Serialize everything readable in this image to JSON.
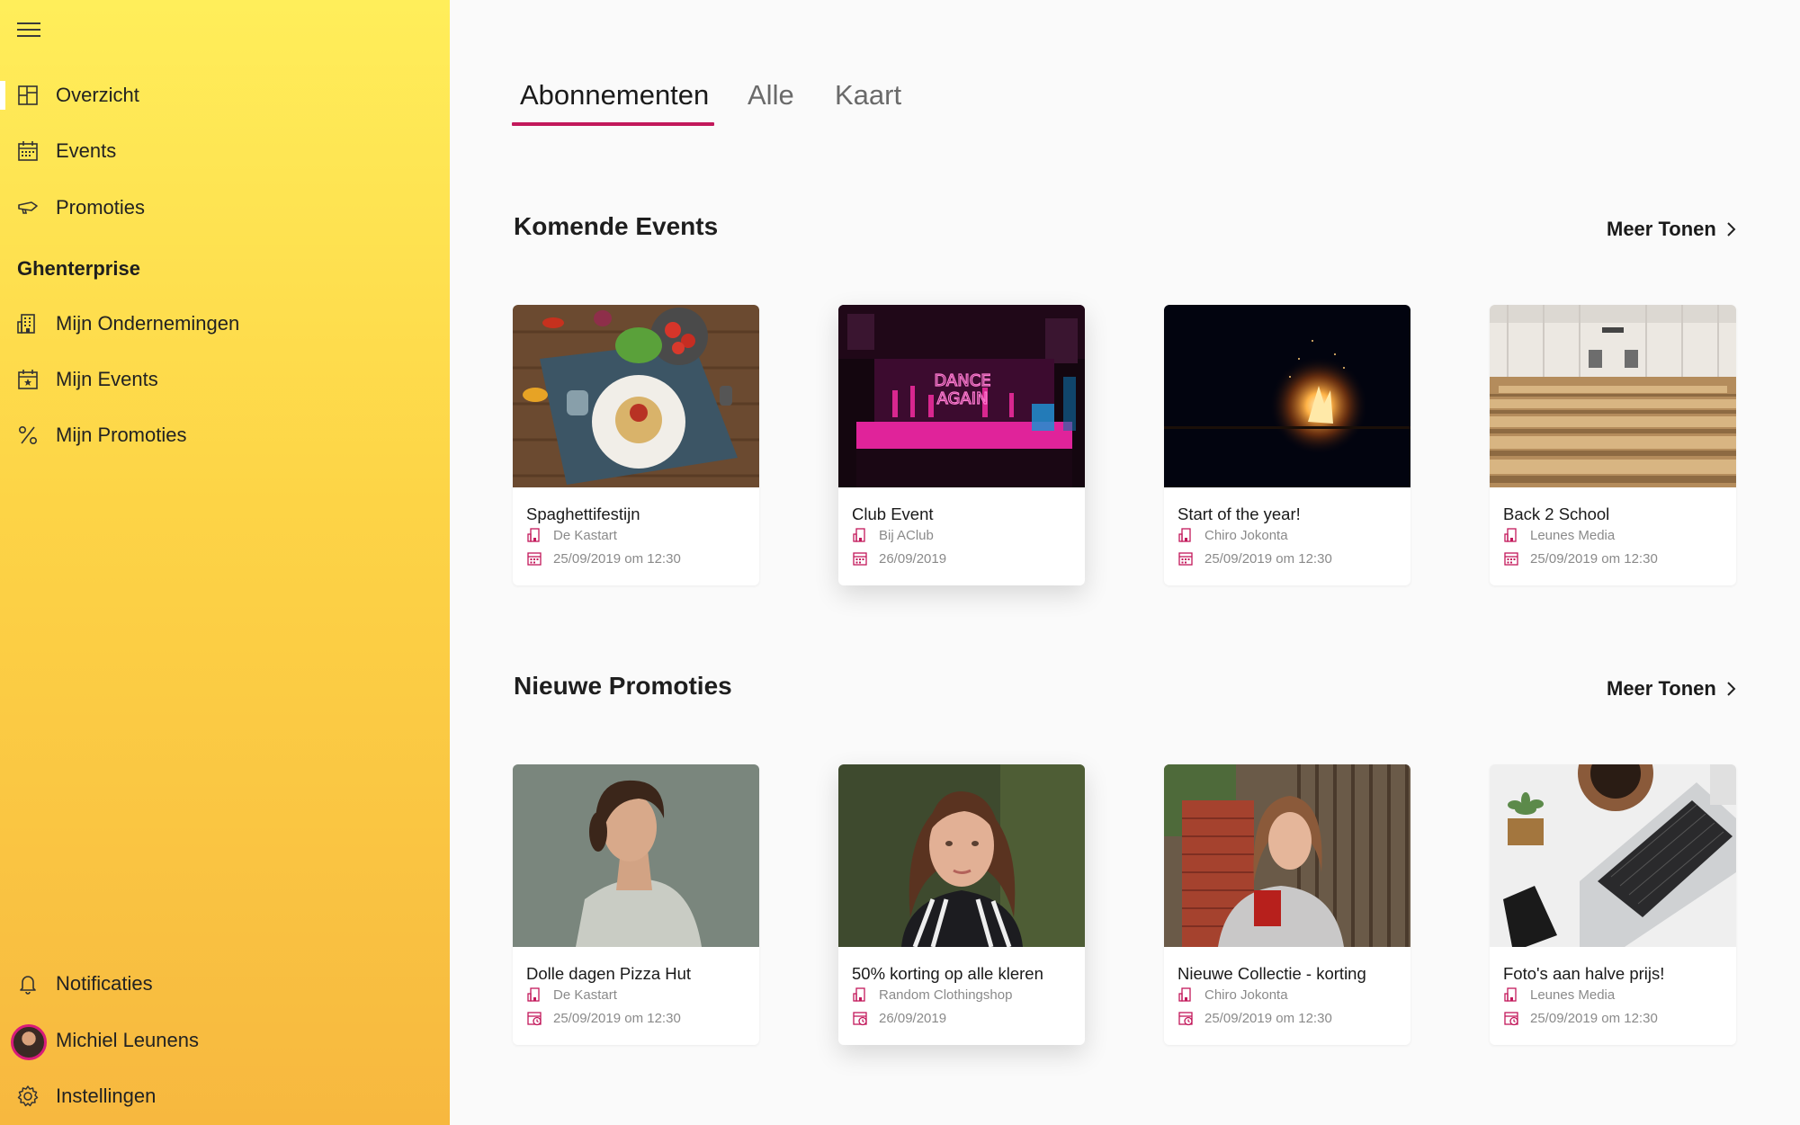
{
  "sidebar": {
    "nav": [
      {
        "label": "Overzicht",
        "icon": "dashboard-icon",
        "active": true
      },
      {
        "label": "Events",
        "icon": "calendar-icon"
      },
      {
        "label": "Promoties",
        "icon": "megaphone-icon"
      }
    ],
    "group_title": "Ghenterprise",
    "group_items": [
      {
        "label": "Mijn Ondernemingen",
        "icon": "building-icon"
      },
      {
        "label": "Mijn Events",
        "icon": "calendar-star-icon"
      },
      {
        "label": "Mijn Promoties",
        "icon": "percent-icon"
      }
    ],
    "bottom": {
      "notifications": "Notificaties",
      "user_name": "Michiel Leunens",
      "settings": "Instellingen"
    }
  },
  "tabs": [
    {
      "label": "Abonnementen",
      "active": true
    },
    {
      "label": "Alle"
    },
    {
      "label": "Kaart"
    }
  ],
  "events": {
    "title": "Komende Events",
    "more": "Meer Tonen",
    "cards": [
      {
        "title": "Spaghettifestijn",
        "org": "De Kastart",
        "date": "25/09/2019 om 12:30",
        "image": "food-photo"
      },
      {
        "title": "Club Event",
        "org": "Bij AClub",
        "date": "26/09/2019",
        "image": "neon-club-photo",
        "neon_text": "DANCE AGAIN"
      },
      {
        "title": "Start of the year!",
        "org": "Chiro Jokonta",
        "date": "25/09/2019 om 12:30",
        "image": "campfire-photo"
      },
      {
        "title": "Back 2 School",
        "org": "Leunes Media",
        "date": "25/09/2019 om 12:30",
        "image": "auditorium-photo"
      }
    ]
  },
  "promotions": {
    "title": "Nieuwe Promoties",
    "more": "Meer Tonen",
    "cards": [
      {
        "title": "Dolle dagen Pizza Hut",
        "org": "De Kastart",
        "date": "25/09/2019 om 12:30",
        "image": "man-portrait-photo"
      },
      {
        "title": "50% korting op alle kleren",
        "org": "Random Clothingshop",
        "date": "26/09/2019",
        "image": "woman-portrait-photo"
      },
      {
        "title": "Nieuwe Collectie - korting",
        "org": "Chiro Jokonta",
        "date": "25/09/2019 om 12:30",
        "image": "girl-brick-wall-photo"
      },
      {
        "title": "Foto's aan halve prijs!",
        "org": "Leunes Media",
        "date": "25/09/2019 om 12:30",
        "image": "laptop-desk-photo"
      }
    ]
  },
  "colors": {
    "accent": "#c2185b",
    "sidebar_top": "#ffee5a",
    "sidebar_bottom": "#f7b83f"
  }
}
